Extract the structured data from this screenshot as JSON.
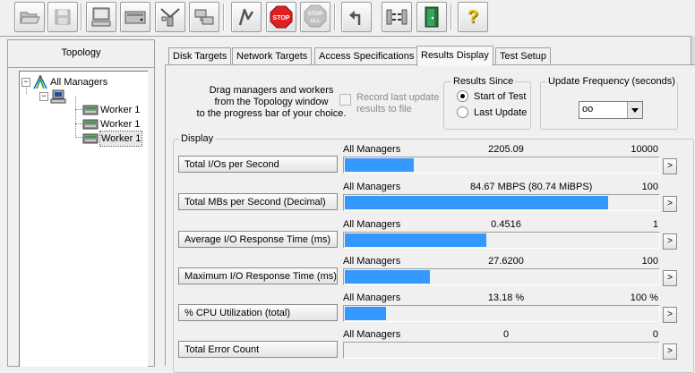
{
  "toolbar": {
    "buttons": [
      {
        "icon": "open-folder-icon",
        "name": "open-button"
      },
      {
        "icon": "save-disk-icon",
        "name": "save-button"
      },
      {
        "icon": "display-new-manager-icon",
        "name": "start-manager-button"
      },
      {
        "icon": "new-disk-worker-icon",
        "name": "new-disk-worker-button"
      },
      {
        "icon": "new-network-worker-icon",
        "name": "new-network-worker-button"
      },
      {
        "icon": "duplicate-worker-icon",
        "name": "duplicate-worker-button"
      },
      {
        "icon": "start-green-flag-icon",
        "name": "start-tests-button"
      },
      {
        "icon": "stop-sign-icon",
        "name": "stop-button"
      },
      {
        "icon": "stop-all-icon",
        "name": "stop-all-button"
      },
      {
        "icon": "reset-arrow-icon",
        "name": "reset-workers-button"
      },
      {
        "icon": "disconnect-managers-icon",
        "name": "disconnect-button"
      },
      {
        "icon": "exit-door-icon",
        "name": "exit-button"
      },
      {
        "icon": "help-question-icon",
        "name": "help-button"
      }
    ],
    "stop_text": "STOP",
    "stop_all_text_top": "STOP",
    "stop_all_text_bottom": "ALL",
    "help_text": "?"
  },
  "topology": {
    "header": "Topology",
    "root": "All Managers",
    "expand_root": "−",
    "expand_manager": "−",
    "workers": [
      "Worker 1",
      "Worker 1",
      "Worker 1"
    ]
  },
  "tabs": [
    {
      "label": "Disk Targets",
      "active": false
    },
    {
      "label": "Network Targets",
      "active": false
    },
    {
      "label": "Access Specifications",
      "active": false
    },
    {
      "label": "Results Display",
      "active": true
    },
    {
      "label": "Test Setup",
      "active": false
    }
  ],
  "results": {
    "drag_text": [
      "Drag managers and workers",
      "from the Topology window",
      "to the progress bar of your choice."
    ],
    "record_label": [
      "Record last update",
      "results to file"
    ],
    "results_since": {
      "title": "Results Since",
      "options": [
        {
          "label": "Start of Test",
          "selected": true
        },
        {
          "label": "Last Update",
          "selected": false
        }
      ]
    },
    "update_frequency": {
      "title": "Update Frequency (seconds)",
      "value": "oo"
    },
    "display_title": "Display",
    "metrics": [
      {
        "name": "Total I/Os per Second",
        "manager": "All Managers",
        "value": "2205.09",
        "max": "10000",
        "fill": 0.22
      },
      {
        "name": "Total MBs per Second (Decimal)",
        "manager": "All Managers",
        "value": "84.67 MBPS (80.74 MiBPS)",
        "max": "100",
        "fill": 0.84
      },
      {
        "name": "Average I/O Response Time (ms)",
        "manager": "All Managers",
        "value": "0.4516",
        "max": "1",
        "fill": 0.45
      },
      {
        "name": "Maximum I/O Response Time (ms)",
        "manager": "All Managers",
        "value": "27.6200",
        "max": "100",
        "fill": 0.27
      },
      {
        "name": "% CPU Utilization (total)",
        "manager": "All Managers",
        "value": "13.18 %",
        "max": "100 %",
        "fill": 0.13
      },
      {
        "name": "Total Error Count",
        "manager": "All Managers",
        "value": "0",
        "max": "0",
        "fill": 0
      }
    ],
    "more_label": ">"
  }
}
